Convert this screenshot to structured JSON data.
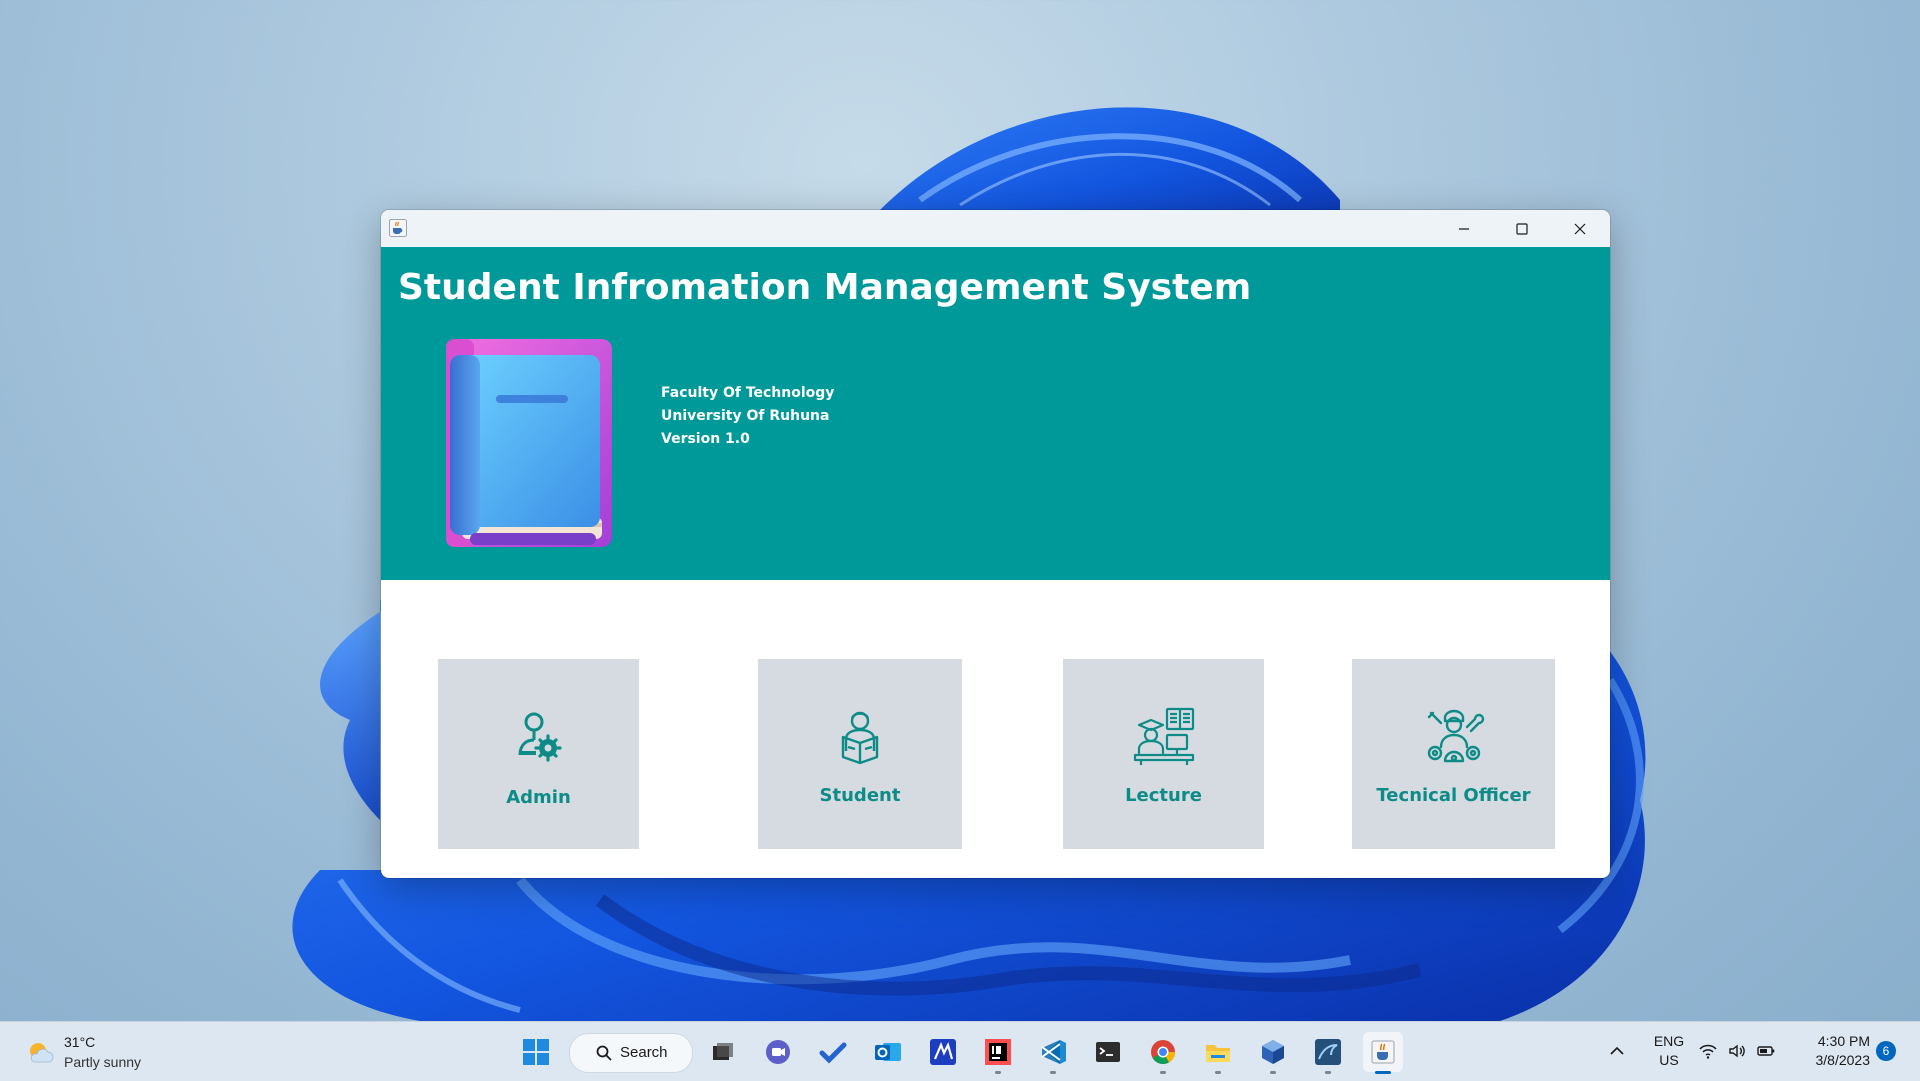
{
  "window": {
    "title_icon": "java-coffee-cup-icon",
    "controls": [
      "minimize-icon",
      "maximize-icon",
      "close-icon"
    ]
  },
  "header": {
    "title": "Student Infromation Management System",
    "background": "#009999",
    "info": [
      "Faculty Of Technology",
      "University Of Ruhuna",
      "Version 1.0"
    ]
  },
  "cards": [
    {
      "label": "Admin",
      "icon": "admin-settings-icon"
    },
    {
      "label": "Student",
      "icon": "student-reading-icon"
    },
    {
      "label": "Lecture",
      "icon": "lecturer-icon"
    },
    {
      "label": "Tecnical Officer",
      "icon": "technician-icon"
    }
  ],
  "colors": {
    "accent": "#009999",
    "card_bg": "#d6dbe1",
    "card_text": "#0d8b86"
  },
  "taskbar": {
    "weather": {
      "temp": "31°C",
      "desc": "Partly sunny"
    },
    "search": "Search",
    "apps": [
      "windows-start-icon",
      "search-icon",
      "task-view-icon",
      "teams-chat-icon",
      "todo-icon",
      "outlook-icon",
      "visual-paradigm-icon",
      "intellij-icon",
      "vscode-icon",
      "terminal-icon",
      "chrome-icon",
      "file-explorer-icon",
      "virtualbox-icon",
      "mysql-workbench-icon",
      "java-app-icon"
    ],
    "lang": {
      "line1": "ENG",
      "line2": "US"
    },
    "time": "4:30 PM",
    "date": "3/8/2023",
    "notifications": "6"
  }
}
